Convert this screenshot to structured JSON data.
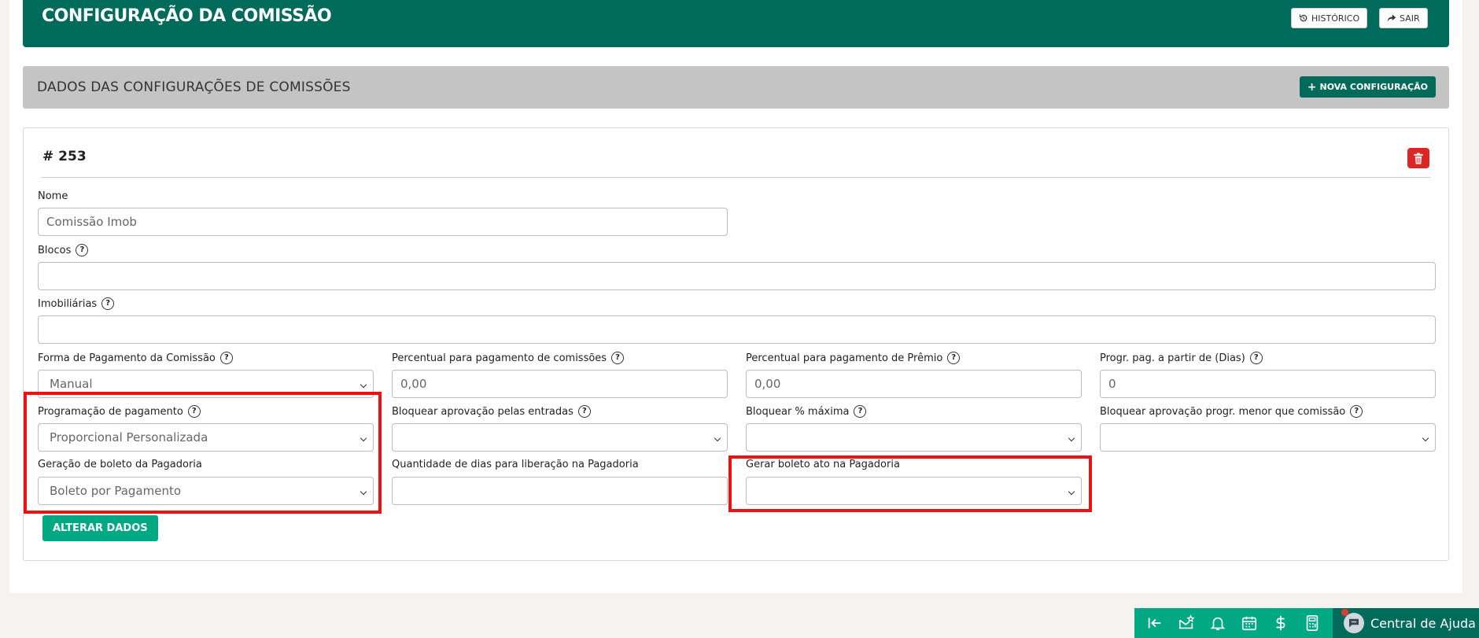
{
  "header": {
    "title": "CONFIGURAÇÃO DA COMISSÃO",
    "historico_label": "HISTÓRICO",
    "sair_label": "SAIR"
  },
  "section": {
    "title": "DADOS DAS CONFIGURAÇÕES DE COMISSÕES",
    "nova_label": "NOVA CONFIGURAÇÃO"
  },
  "card": {
    "id": "# 253",
    "nome_label": "Nome",
    "nome_value": "Comissão Imob",
    "blocos_label": "Blocos",
    "blocos_value": "",
    "imobiliarias_label": "Imobiliárias",
    "imobiliarias_value": "",
    "forma_label": "Forma de Pagamento da Comissão",
    "forma_value": "Manual",
    "percentual_comissoes_label": "Percentual para pagamento de comissões",
    "percentual_comissoes_value": "0,00",
    "percentual_premio_label": "Percentual para pagamento de Prêmio",
    "percentual_premio_value": "0,00",
    "progr_dias_label": "Progr. pag. a partir de (Dias)",
    "progr_dias_value": "0",
    "programacao_label": "Programação de pagamento",
    "programacao_value": "Proporcional Personalizada",
    "bloquear_entradas_label": "Bloquear aprovação pelas entradas",
    "bloquear_entradas_value": "",
    "bloquear_max_label": "Bloquear % máxima",
    "bloquear_max_value": "",
    "bloquear_progr_label": "Bloquear aprovação progr. menor que comissão",
    "bloquear_progr_value": "",
    "geracao_label": "Geração de boleto da Pagadoria",
    "geracao_value": "Boleto por Pagamento",
    "qtd_dias_label": "Quantidade de dias para liberação na Pagadoria",
    "qtd_dias_value": "",
    "gerar_ato_label": "Gerar boleto ato na Pagadoria",
    "gerar_ato_value": "",
    "alterar_label": "ALTERAR DADOS",
    "help_glyph": "?"
  },
  "footer": {
    "help_label": "Central de Ajuda",
    "icons": [
      "collapse-left-icon",
      "mail-star-icon",
      "bell-icon",
      "calendar-icon",
      "dollar-icon",
      "calculator-icon"
    ]
  },
  "colors": {
    "primary": "#006b5a",
    "accent": "#00a884",
    "danger": "#dc2626",
    "highlight": "#ee1111"
  }
}
